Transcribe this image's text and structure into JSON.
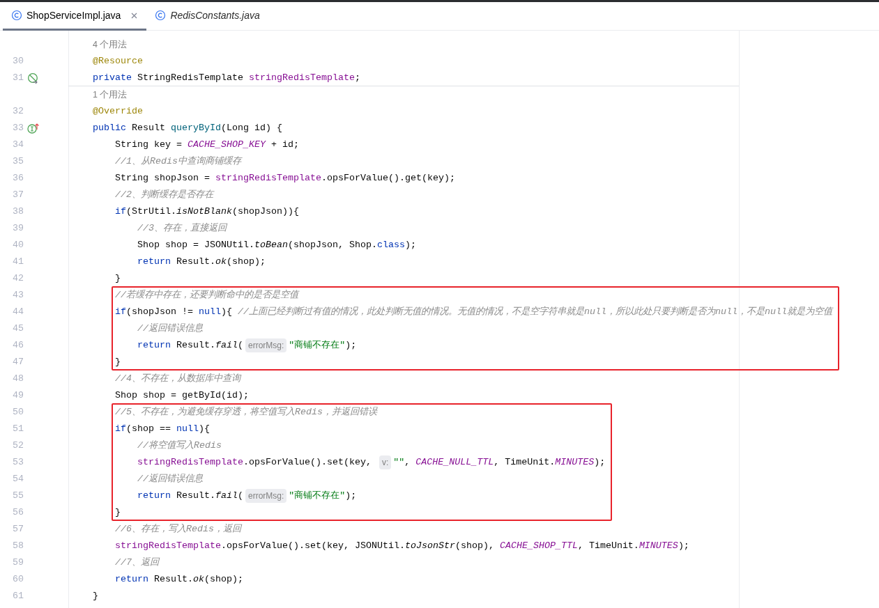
{
  "tabs": [
    {
      "label": "ShopServiceImpl.java",
      "selected": true,
      "preview": false
    },
    {
      "label": "RedisConstants.java",
      "selected": false,
      "preview": true
    }
  ],
  "editor": {
    "rows": [
      {
        "kind": "usages",
        "text": "4 个用法"
      },
      {
        "kind": "code",
        "number": "30",
        "tokens": [
          {
            "kind": "annotation",
            "text": "    @Resource"
          }
        ]
      },
      {
        "kind": "code",
        "number": "31",
        "gutter_icon": {
          "kind": "bean"
        },
        "separator": true,
        "tokens": [
          {
            "kind": "keyword",
            "text": "    private "
          },
          {
            "kind": "plain",
            "text": "StringRedisTemplate "
          },
          {
            "kind": "field",
            "text": "stringRedisTemplate"
          },
          {
            "kind": "plain",
            "text": ";"
          }
        ]
      },
      {
        "kind": "usages",
        "text": "1 个用法"
      },
      {
        "kind": "code",
        "number": "32",
        "tokens": [
          {
            "kind": "annotation",
            "text": "    @Override"
          }
        ]
      },
      {
        "kind": "code",
        "number": "33",
        "gutter_icon": {
          "kind": "implements"
        },
        "tokens": [
          {
            "kind": "keyword",
            "text": "    public "
          },
          {
            "kind": "plain",
            "text": "Result "
          },
          {
            "kind": "method_decl",
            "text": "queryById"
          },
          {
            "kind": "plain",
            "text": "(Long id) {"
          }
        ]
      },
      {
        "kind": "code",
        "number": "34",
        "tokens": [
          {
            "kind": "plain",
            "text": "        String key = "
          },
          {
            "kind": "static_field",
            "text": "CACHE_SHOP_KEY"
          },
          {
            "kind": "plain",
            "text": " + id;"
          }
        ]
      },
      {
        "kind": "code",
        "number": "35",
        "tokens": [
          {
            "kind": "comment",
            "text": "        //1、从Redis中查询商铺缓存"
          }
        ]
      },
      {
        "kind": "code",
        "number": "36",
        "tokens": [
          {
            "kind": "plain",
            "text": "        String shopJson = "
          },
          {
            "kind": "field",
            "text": "stringRedisTemplate"
          },
          {
            "kind": "plain",
            "text": ".opsForValue().get(key);"
          }
        ]
      },
      {
        "kind": "code",
        "number": "37",
        "tokens": [
          {
            "kind": "comment",
            "text": "        //2、判断缓存是否存在"
          }
        ]
      },
      {
        "kind": "code",
        "number": "38",
        "tokens": [
          {
            "kind": "keyword",
            "text": "        if"
          },
          {
            "kind": "plain",
            "text": "(StrUtil."
          },
          {
            "kind": "static_call",
            "text": "isNotBlank"
          },
          {
            "kind": "plain",
            "text": "(shopJson)){"
          }
        ]
      },
      {
        "kind": "code",
        "number": "39",
        "tokens": [
          {
            "kind": "comment",
            "text": "            //3、存在，直接返回"
          }
        ]
      },
      {
        "kind": "code",
        "number": "40",
        "tokens": [
          {
            "kind": "plain",
            "text": "            Shop shop = JSONUtil."
          },
          {
            "kind": "static_call",
            "text": "toBean"
          },
          {
            "kind": "plain",
            "text": "(shopJson, Shop."
          },
          {
            "kind": "keyword",
            "text": "class"
          },
          {
            "kind": "plain",
            "text": ");"
          }
        ]
      },
      {
        "kind": "code",
        "number": "41",
        "tokens": [
          {
            "kind": "keyword",
            "text": "            return "
          },
          {
            "kind": "plain",
            "text": "Result."
          },
          {
            "kind": "static_call",
            "text": "ok"
          },
          {
            "kind": "plain",
            "text": "(shop);"
          }
        ]
      },
      {
        "kind": "code",
        "number": "42",
        "tokens": [
          {
            "kind": "plain",
            "text": "        }"
          }
        ]
      },
      {
        "kind": "highlight",
        "rows": [
          {
            "kind": "code",
            "number": "43",
            "tokens": [
              {
                "kind": "comment",
                "text": "        //若缓存中存在，还要判断命中的是否是空值"
              }
            ]
          },
          {
            "kind": "code",
            "number": "44",
            "tokens": [
              {
                "kind": "keyword",
                "text": "        if"
              },
              {
                "kind": "plain",
                "text": "(shopJson != "
              },
              {
                "kind": "keyword",
                "text": "null"
              },
              {
                "kind": "plain",
                "text": "){ "
              },
              {
                "kind": "comment",
                "text": "//上面已经判断过有值的情况，此处判断无值的情况。无值的情况，不是空字符串就是null，所以此处只要判断是否为null，不是null就是为空值"
              }
            ]
          },
          {
            "kind": "code",
            "number": "45",
            "tokens": [
              {
                "kind": "comment",
                "text": "            //返回错误信息"
              }
            ]
          },
          {
            "kind": "code",
            "number": "46",
            "tokens": [
              {
                "kind": "keyword",
                "text": "            return "
              },
              {
                "kind": "plain",
                "text": "Result."
              },
              {
                "kind": "static_call",
                "text": "fail"
              },
              {
                "kind": "plain",
                "text": "("
              },
              {
                "kind": "param_hint",
                "text": "errorMsg:"
              },
              {
                "kind": "string",
                "text": "\"商铺不存在\""
              },
              {
                "kind": "plain",
                "text": ");"
              }
            ]
          },
          {
            "kind": "code",
            "number": "47",
            "tokens": [
              {
                "kind": "plain",
                "text": "        }"
              }
            ]
          }
        ]
      },
      {
        "kind": "code",
        "number": "48",
        "tokens": [
          {
            "kind": "comment",
            "text": "        //4、不存在，从数据库中查询"
          }
        ]
      },
      {
        "kind": "code",
        "number": "49",
        "tokens": [
          {
            "kind": "plain",
            "text": "        Shop shop = getById(id);"
          }
        ]
      },
      {
        "kind": "highlight",
        "rows": [
          {
            "kind": "code",
            "number": "50",
            "tokens": [
              {
                "kind": "comment",
                "text": "        //5、不存在，为避免缓存穿透，将空值写入Redis，并返回错误"
              }
            ]
          },
          {
            "kind": "code",
            "number": "51",
            "tokens": [
              {
                "kind": "keyword",
                "text": "        if"
              },
              {
                "kind": "plain",
                "text": "(shop == "
              },
              {
                "kind": "keyword",
                "text": "null"
              },
              {
                "kind": "plain",
                "text": "){"
              }
            ]
          },
          {
            "kind": "code",
            "number": "52",
            "tokens": [
              {
                "kind": "comment",
                "text": "            //将空值写入Redis"
              }
            ]
          },
          {
            "kind": "code",
            "number": "53",
            "tokens": [
              {
                "kind": "field",
                "text": "            stringRedisTemplate"
              },
              {
                "kind": "plain",
                "text": ".opsForValue().set(key, "
              },
              {
                "kind": "param_hint",
                "text": "v:"
              },
              {
                "kind": "string",
                "text": "\"\""
              },
              {
                "kind": "plain",
                "text": ", "
              },
              {
                "kind": "static_field",
                "text": "CACHE_NULL_TTL"
              },
              {
                "kind": "plain",
                "text": ", TimeUnit."
              },
              {
                "kind": "static_field",
                "text": "MINUTES"
              },
              {
                "kind": "plain",
                "text": ");"
              }
            ]
          },
          {
            "kind": "code",
            "number": "54",
            "tokens": [
              {
                "kind": "comment",
                "text": "            //返回错误信息"
              }
            ]
          },
          {
            "kind": "code",
            "number": "55",
            "tokens": [
              {
                "kind": "keyword",
                "text": "            return "
              },
              {
                "kind": "plain",
                "text": "Result."
              },
              {
                "kind": "static_call",
                "text": "fail"
              },
              {
                "kind": "plain",
                "text": "("
              },
              {
                "kind": "param_hint",
                "text": "errorMsg:"
              },
              {
                "kind": "string",
                "text": "\"商铺不存在\""
              },
              {
                "kind": "plain",
                "text": ");"
              }
            ]
          },
          {
            "kind": "code",
            "number": "56",
            "tokens": [
              {
                "kind": "plain",
                "text": "        }"
              }
            ]
          }
        ]
      },
      {
        "kind": "code",
        "number": "57",
        "tokens": [
          {
            "kind": "comment",
            "text": "        //6、存在，写入Redis，返回"
          }
        ]
      },
      {
        "kind": "code",
        "number": "58",
        "tokens": [
          {
            "kind": "field",
            "text": "        stringRedisTemplate"
          },
          {
            "kind": "plain",
            "text": ".opsForValue().set(key, JSONUtil."
          },
          {
            "kind": "static_call",
            "text": "toJsonStr"
          },
          {
            "kind": "plain",
            "text": "(shop), "
          },
          {
            "kind": "static_field",
            "text": "CACHE_SHOP_TTL"
          },
          {
            "kind": "plain",
            "text": ", TimeUnit."
          },
          {
            "kind": "static_field",
            "text": "MINUTES"
          },
          {
            "kind": "plain",
            "text": ");"
          }
        ]
      },
      {
        "kind": "code",
        "number": "59",
        "tokens": [
          {
            "kind": "comment",
            "text": "        //7、返回"
          }
        ]
      },
      {
        "kind": "code",
        "number": "60",
        "tokens": [
          {
            "kind": "keyword",
            "text": "        return "
          },
          {
            "kind": "plain",
            "text": "Result."
          },
          {
            "kind": "static_call",
            "text": "ok"
          },
          {
            "kind": "plain",
            "text": "(shop);"
          }
        ]
      },
      {
        "kind": "code",
        "number": "61",
        "tokens": [
          {
            "kind": "plain",
            "text": "    }"
          }
        ]
      }
    ]
  }
}
